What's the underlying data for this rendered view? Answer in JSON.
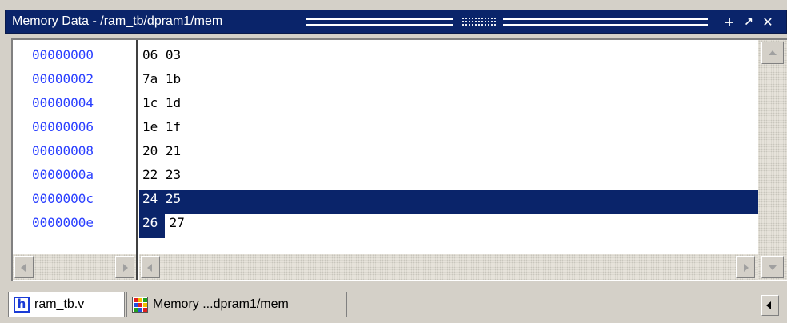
{
  "window": {
    "title": "Memory Data - /ram_tb/dpram1/mem"
  },
  "title_buttons": {
    "add": "+",
    "undock": "↗",
    "close": "✕"
  },
  "memory": {
    "rows": [
      {
        "address": "00000000",
        "data": "06 03"
      },
      {
        "address": "00000002",
        "data": "7a 1b"
      },
      {
        "address": "00000004",
        "data": "1c 1d"
      },
      {
        "address": "00000006",
        "data": "1e 1f"
      },
      {
        "address": "00000008",
        "data": "20 21"
      },
      {
        "address": "0000000a",
        "data": "22 23"
      },
      {
        "address": "0000000c",
        "data": "24 25"
      },
      {
        "address": "0000000e",
        "data": "26 27"
      }
    ],
    "selected_row_index": 6,
    "selected_cell_row7": "26",
    "row7_rest": " 27"
  },
  "tabs": [
    {
      "label": "ram_tb.v",
      "icon": "verilog-file-icon",
      "active": true
    },
    {
      "label": "Memory ...dpram1/mem",
      "icon": "memory-icon",
      "active": false
    }
  ],
  "colors": {
    "title_bar": "#0a246a",
    "address_text": "#2a3fff",
    "selection": "#0a246a"
  }
}
